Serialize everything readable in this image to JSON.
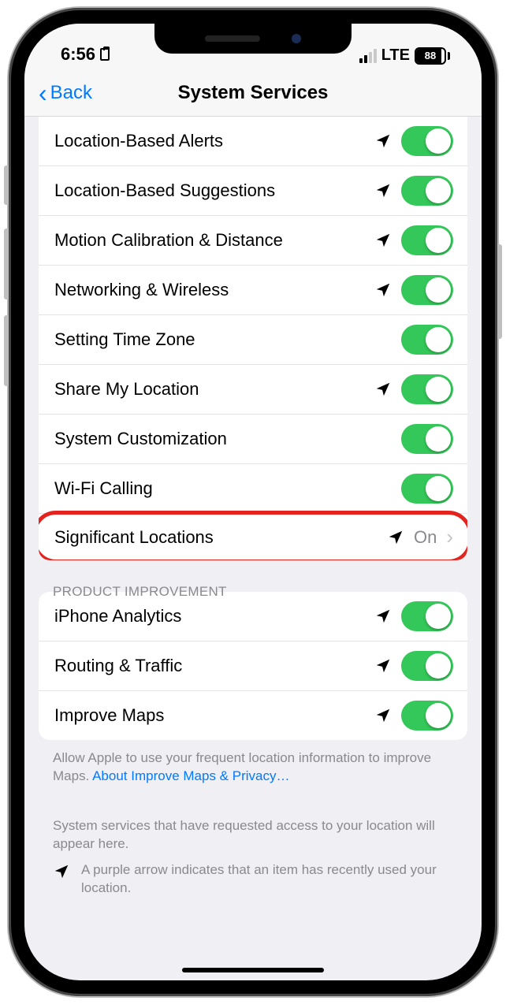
{
  "status": {
    "time": "6:56",
    "network": "LTE",
    "battery": "88"
  },
  "nav": {
    "back": "Back",
    "title": "System Services"
  },
  "rows": {
    "r0": {
      "label": "Location-Based Alerts",
      "arrow": "purple",
      "toggle": true
    },
    "r1": {
      "label": "Location-Based Suggestions",
      "arrow": "gray",
      "toggle": true
    },
    "r2": {
      "label": "Motion Calibration & Distance",
      "arrow": "purple",
      "toggle": true
    },
    "r3": {
      "label": "Networking & Wireless",
      "arrow": "purple",
      "toggle": true
    },
    "r4": {
      "label": "Setting Time Zone",
      "arrow": null,
      "toggle": true
    },
    "r5": {
      "label": "Share My Location",
      "arrow": "gray",
      "toggle": true
    },
    "r6": {
      "label": "System Customization",
      "arrow": null,
      "toggle": true
    },
    "r7": {
      "label": "Wi-Fi Calling",
      "arrow": null,
      "toggle": true
    },
    "r8": {
      "label": "Significant Locations",
      "arrow": "outline",
      "value": "On"
    }
  },
  "section2_header": "PRODUCT IMPROVEMENT",
  "rows2": {
    "p0": {
      "label": "iPhone Analytics",
      "arrow": "gray",
      "toggle": true
    },
    "p1": {
      "label": "Routing & Traffic",
      "arrow": "purple",
      "toggle": true
    },
    "p2": {
      "label": "Improve Maps",
      "arrow": "purple",
      "toggle": true
    }
  },
  "footer1_text": "Allow Apple to use your frequent location information to improve Maps. ",
  "footer1_link": "About Improve Maps & Privacy…",
  "footer2": "System services that have requested access to your location will appear here.",
  "legend_text": "A purple arrow indicates that an item has recently used your location."
}
